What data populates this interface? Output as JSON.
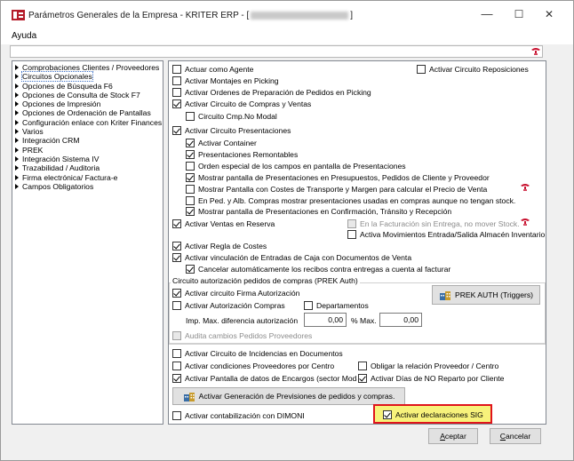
{
  "window": {
    "title_prefix": "Parámetros Generales de la Empresa - KRITER ERP - [",
    "title_suffix": "]",
    "minimize": "—",
    "maximize": "☐",
    "close": "✕"
  },
  "menu": {
    "help": "Ayuda"
  },
  "tree": {
    "items": [
      "Comprobaciones Clientes / Proveedores",
      "Circuitos Opcionales",
      "Opciones de Búsqueda F6",
      "Opciones de Consulta de Stock F7",
      "Opciones de Impresión",
      "Opciones de Ordenación de Pantallas",
      "Configuración enlace con Kriter Finances",
      "Varios",
      "Integración CRM",
      "PREK",
      "Integración Sistema IV",
      "Trazabilidad / Auditoria",
      "Firma electrónica/ Factura-e",
      "Campos Obligatorios"
    ],
    "selected_index": 1
  },
  "options": {
    "actuar_agente": "Actuar como Agente",
    "activar_circuito_reposiciones": "Activar Circuito Reposiciones",
    "montajes_picking": "Activar Montajes en Picking",
    "ordenes_preparacion": "Activar Ordenes de Preparación de Pedidos en Picking",
    "circuito_compras_ventas": "Activar Circuito de Compras y Ventas",
    "circuito_cmp_no_modal": "Circuito Cmp.No Modal",
    "circuito_presentaciones": "Activar Circuito Presentaciones",
    "activar_container": "Activar Container",
    "presentaciones_remontables": "Presentaciones Remontables",
    "orden_especial": "Orden especial de los campos en pantalla de Presentaciones",
    "mostrar_pantalla_presentaciones": "Mostrar pantalla de Presentaciones en Presupuestos, Pedidos de Cliente y Proveedor",
    "mostrar_costes_transporte": "Mostrar Pantalla con Costes de Transporte y Margen para calcular el Precio de Venta",
    "en_ped_alb": "En Ped. y Alb. Compras mostrar presentaciones usadas en compras aunque no tengan stock.",
    "mostrar_confirmacion": "Mostrar pantalla de Presentaciones en Confirmación, Tránsito y Recepción",
    "ventas_reserva": "Activar Ventas en Reserva",
    "facturacion_sin_entrega": "En la Facturación sin Entrega, no mover Stock.",
    "activa_movimientos": "Activa Movimientos Entrada/Salida Almacén Inventario",
    "regla_costes": "Activar Regla de Costes",
    "vinculacion_entradas": "Activar vinculación de Entradas de Caja con Documentos de Venta",
    "cancelar_recibos": "Cancelar automáticamente los recibos contra entregas a cuenta al facturar",
    "circuito_incidencias": "Activar Circuito de Incidencias en Documentos",
    "condiciones_proveedores": "Activar condiciones Proveedores por Centro",
    "obligar_relacion": "Obligar la relación Proveedor / Centro",
    "pantalla_encargos": "Activar Pantalla de datos de Encargos (sector Moda)",
    "dias_no_reparto": "Activar Días de NO Reparto por Cliente",
    "contabilizacion_dimoni": "Activar contabilización con DIMONI",
    "declaraciones_sig": "Activar declaraciones SIG"
  },
  "prek_group": {
    "title": "Circuito autorización  pedidos de compras (PREK Auth)",
    "firma_autorizacion": "Activar circuito Firma Autorización",
    "autorizacion_compras": "Activar Autorización Compras",
    "departamentos": "Departamentos",
    "imp_max_label": "Imp. Max. diferencia autorización",
    "imp_max_value": "0,00",
    "pct_max_label": "% Max.",
    "pct_max_value": "0,00",
    "audita_cambios": "Audita cambios Pedidos Proveedores",
    "prek_button": "PREK AUTH  (Triggers)"
  },
  "buttons": {
    "generacion_previsiones": "Activar Generación de Previsiones de pedidos y compras.",
    "accept_first": "A",
    "accept_rest": "ceptar",
    "cancel_first": "C",
    "cancel_rest": "ancelar"
  },
  "colors": {
    "highlight_border": "#e0141b",
    "highlight_fill": "#f7f27b",
    "help_icon": "#c8102e"
  }
}
